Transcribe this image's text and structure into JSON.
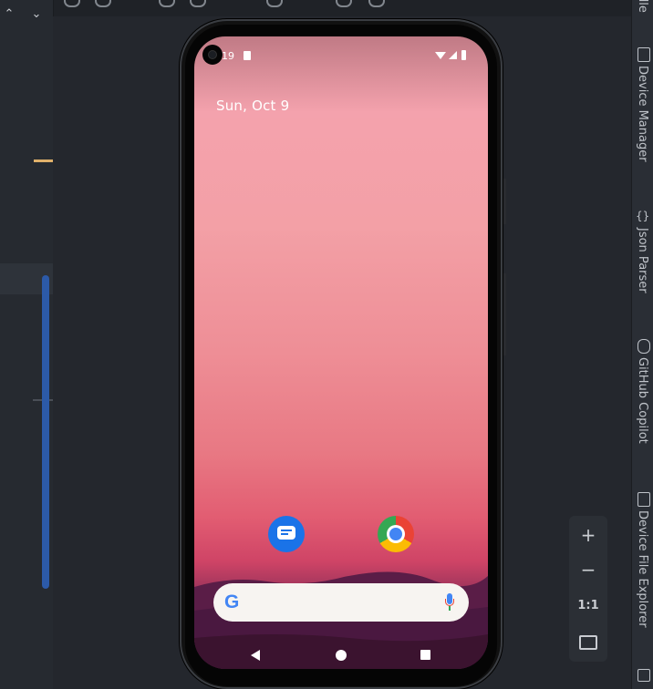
{
  "status_bar": {
    "time_fragment": "19"
  },
  "home": {
    "date": "Sun, Oct 9"
  },
  "apps": [
    {
      "icon": "messages-icon"
    },
    {
      "icon": "chrome-icon"
    }
  ],
  "search": {
    "logo": "G"
  },
  "zoom": {
    "zoom_in": "+",
    "zoom_out": "−",
    "actual_size": "1:1"
  },
  "right_tabs": [
    {
      "label": "Device Manager"
    },
    {
      "label": "Json Parser"
    },
    {
      "label": "GitHub Copilot"
    },
    {
      "label": "Device File Explorer"
    }
  ],
  "partial_tab": {
    "label": "dle"
  },
  "colors": {
    "accent_scroll": "#2c5aa8",
    "tick": "#e0b16a"
  }
}
